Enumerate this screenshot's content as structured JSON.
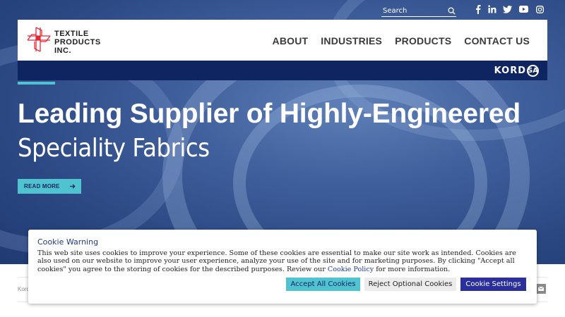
{
  "search": {
    "placeholder": "Search"
  },
  "social": [
    {
      "name": "facebook-icon",
      "glyph": "f"
    },
    {
      "name": "linkedin-icon",
      "glyph": "in"
    },
    {
      "name": "twitter-icon",
      "glyph": "t"
    },
    {
      "name": "youtube-icon",
      "glyph": "yt"
    },
    {
      "name": "instagram-icon",
      "glyph": "ig"
    }
  ],
  "logo": {
    "line1": "TEXTILE",
    "line2": "PRODUCTS",
    "line3": "INC."
  },
  "nav": {
    "items": [
      {
        "label": "ABOUT"
      },
      {
        "label": "INDUSTRIES"
      },
      {
        "label": "PRODUCTS"
      },
      {
        "label": "CONTACT US"
      }
    ]
  },
  "brand": {
    "text": "KORD",
    "circle": "SA"
  },
  "hero": {
    "headline": "Leading Supplier of Highly-Engineered",
    "subheadline": "Speciality Fabrics",
    "cta_label": "READ MORE"
  },
  "breadcrumb": {
    "text": "Kord"
  },
  "cookie": {
    "title": "Cookie Warning",
    "body_before_link": "This web site uses cookies to improve your experience. Some of these cookies are essential to make our site work as intended. Cookies are also used on our website to improve your user experience, analyze your use of the site and for marketing purposes. By clicking \"Accept all cookies\" you agree to the storing of cookies for the described purposes. Review our ",
    "link_text": "Cookie Policy",
    "body_after_link": " for more information.",
    "accept_label": "Accept All Cookies",
    "reject_label": "Reject Optional Cookies",
    "settings_label": "Cookie Settings"
  },
  "colors": {
    "accent": "#4fc3cf",
    "navy": "#0e2561",
    "settings_button": "#2a2f9b",
    "logo_red": "#e0283a"
  }
}
